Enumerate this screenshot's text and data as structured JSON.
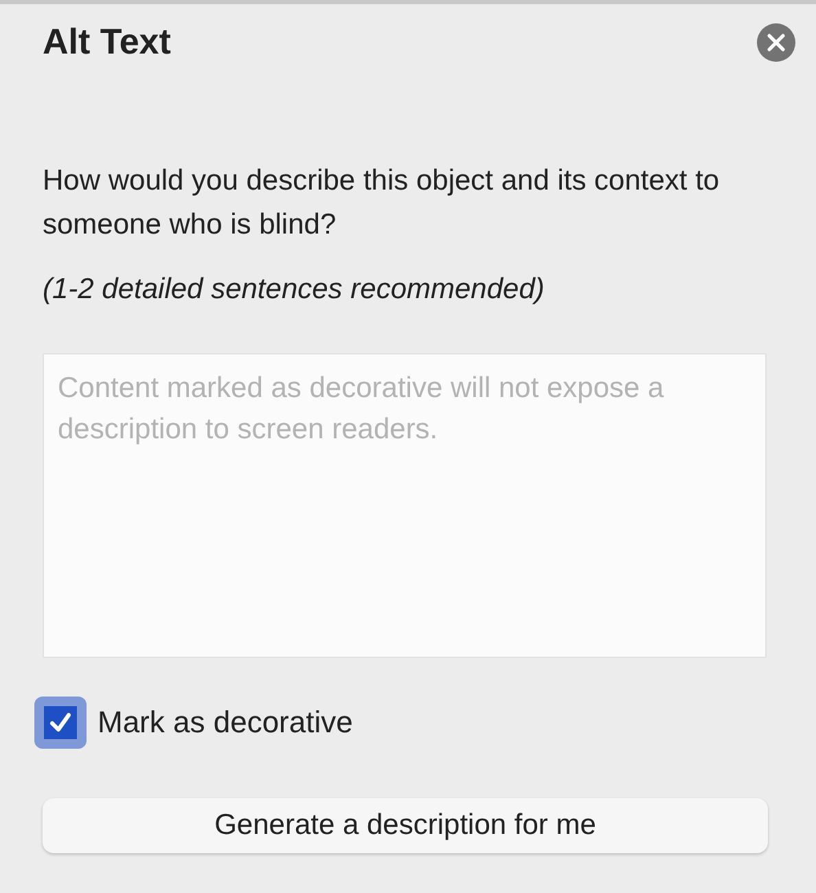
{
  "panel": {
    "title": "Alt Text"
  },
  "prompt": "How would you describe this object and its context to someone who is blind?",
  "hint": "(1-2 detailed sentences recommended)",
  "description": {
    "placeholder": "Content marked as decorative will not expose a description to screen readers."
  },
  "decorative": {
    "label": "Mark as decorative",
    "checked": true
  },
  "buttons": [
    "Generate a description for me"
  ]
}
